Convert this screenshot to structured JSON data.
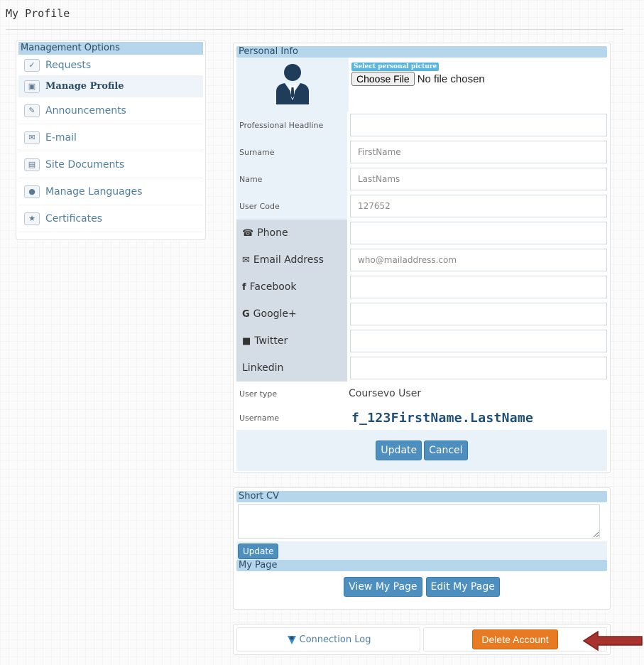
{
  "page": {
    "title": "My Profile"
  },
  "sidebar": {
    "header": "Management Options",
    "items": [
      {
        "label": "Requests",
        "icon": "document-check-icon"
      },
      {
        "label": "Manage Profile",
        "icon": "profile-card-icon"
      },
      {
        "label": "Announcements",
        "icon": "announcement-icon"
      },
      {
        "label": "E-mail",
        "icon": "mail-icon"
      },
      {
        "label": "Site Documents",
        "icon": "documents-icon"
      },
      {
        "label": "Manage Languages",
        "icon": "globe-icon"
      },
      {
        "label": "Certificates",
        "icon": "certificate-icon"
      }
    ]
  },
  "personal_info": {
    "header": "Personal Info",
    "picture_label": "Select personal picture",
    "file_button": "Choose File",
    "file_status": "No file chosen",
    "fields": {
      "headline": {
        "label": "Professional Headline",
        "value": ""
      },
      "surname": {
        "label": "Surname",
        "value": "FirstName"
      },
      "name": {
        "label": "Name",
        "value": "LastNams"
      },
      "user_code": {
        "label": "User Code",
        "value": "127652"
      },
      "phone": {
        "label": "Phone",
        "value": ""
      },
      "email": {
        "label": "Email Address",
        "value": "who@mailaddress.com"
      },
      "facebook": {
        "label": "Facebook",
        "value": ""
      },
      "google": {
        "label": "Google+",
        "value": ""
      },
      "twitter": {
        "label": "Twitter",
        "value": ""
      },
      "linkedin": {
        "label": "Linkedin",
        "value": ""
      }
    },
    "user_type": {
      "label": "User type",
      "value": "Coursevo User"
    },
    "username": {
      "label": "Username",
      "value": "f_123FirstName.LastName"
    },
    "update_button": "Update",
    "cancel_button": "Cancel"
  },
  "short_cv": {
    "header": "Short CV",
    "value": "",
    "update_button": "Update"
  },
  "my_page": {
    "header": "My Page",
    "view_button": "View My Page",
    "edit_button": "Edit My Page"
  },
  "footer": {
    "connection_log": "Connection Log",
    "delete_account": "Delete Account"
  },
  "colors": {
    "header_bg": "#b6d6ec",
    "button_blue": "#4d8fbf",
    "delete_orange": "#e87a22",
    "arrow_red": "#a8322d"
  }
}
